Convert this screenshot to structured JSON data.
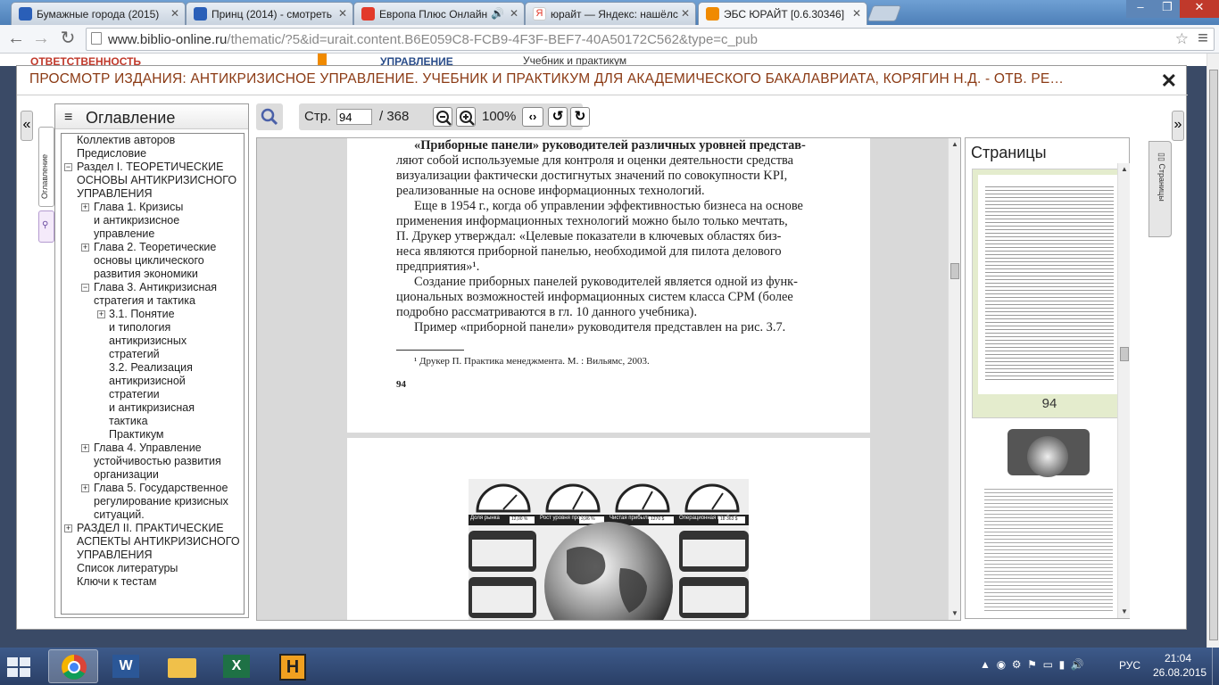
{
  "browser": {
    "tabs": [
      {
        "title": "Бумажные города (2015)",
        "icon_color": "#2a5fb8"
      },
      {
        "title": "Принц (2014) - смотреть",
        "icon_color": "#2a5fb8"
      },
      {
        "title": "Европа Плюс Онлайн",
        "icon_color": "#e23a2a"
      },
      {
        "title": "юрайт — Яндекс: нашёлс",
        "icon_color": "#e23a2a"
      },
      {
        "title": "ЭБС ЮРАЙТ [0.6.30346]",
        "icon_color": "#f08a00"
      }
    ],
    "url_main": "www.biblio-online.ru",
    "url_rest": "/thematic/?5&id=urait.content.B6E059C8-FCB9-4F3F-BEF7-40A50172C562&type=c_pub"
  },
  "background_strip": {
    "left": "ответственность",
    "middle": "управление",
    "right": "Учебник и практикум"
  },
  "viewer": {
    "title": "ПРОСМОТР ИЗДАНИЯ: АНТИКРИЗИСНОЕ УПРАВЛЕНИЕ. УЧЕБНИК И ПРАКТИКУМ ДЛЯ АКАДЕМИЧЕСКОГО БАКАЛАВРИАТА, КОРЯГИН Н.Д. - ОТВ. РЕ…",
    "close": "✕",
    "left_tab_label": "Оглавление",
    "right_tab_label": "Страницы",
    "toc_heading": "Оглавление",
    "toc": [
      "Коллектив авторов",
      "Предисловие",
      "Раздел I. ТЕОРЕТИЧЕСКИЕ",
      "ОСНОВЫ АНТИКРИЗИСНОГО",
      "УПРАВЛЕНИЯ",
      "Глава 1. Кризисы",
      "и антикризисное",
      "управление",
      "Глава 2. Теоретические",
      "основы циклического",
      "развития экономики",
      "Глава 3. Антикризисная",
      "стратегия и тактика",
      "3.1. Понятие",
      "и типология",
      "антикризисных",
      "стратегий",
      "3.2. Реализация",
      "антикризисной",
      "стратегии",
      "и антикризисная",
      "тактика",
      "Практикум",
      "Глава 4. Управление",
      "устойчивостью развития",
      "организации",
      "Глава 5. Государственное",
      "регулирование кризисных",
      "ситуаций.",
      "РАЗДЕЛ II. ПРАКТИЧЕСКИЕ",
      "АСПЕКТЫ АНТИКРИЗИСНОГО",
      "УПРАВЛЕНИЯ",
      "Список литературы",
      "Ключи к тестам"
    ],
    "controls": {
      "page_label": "Стр.",
      "page_value": "94",
      "page_total": "/ 368",
      "zoom": "100%"
    },
    "page_text": [
      "«Приборные панели» руководителей различных уровней представ-",
      "ляют собой используемые для контроля и оценки деятельности средства",
      "визуализации фактически достигнутых значений по совокупности KPI,",
      "реализованные на основе информационных технологий.",
      "Еще в 1954 г., когда об управлении эффективностью бизнеса на основе",
      "применения информационных технологий можно было только мечтать,",
      "П. Друкер утверждал: «Целевые показатели в ключевых областях биз-",
      "неса являются приборной панелью, необходимой для пилота делового",
      "предприятия»¹.",
      "Создание приборных панелей руководителей является одной из функ-",
      "циональных возможностей информационных систем класса CPM (более",
      "подробно рассматриваются в гл. 10 данного учебника).",
      "Пример «приборной панели» руководителя представлен на рис. 3.7."
    ],
    "footnote": "¹ Друкер П. Практика менеджмента. М. : Вильямс, 2003.",
    "page_number": "94",
    "thumb_page_number": "94",
    "pages_heading": "Страницы",
    "dashboard_labels": [
      "Доля рынка",
      "Рост уровня продаж",
      "Чистая прибыль",
      "Операционная прибыль"
    ],
    "dashboard_values": [
      "12,00 %",
      "3,96 %",
      "1270 $",
      "18 363 $"
    ]
  },
  "taskbar": {
    "lang": "РУС",
    "time": "21:04",
    "date": "26.08.2015"
  }
}
